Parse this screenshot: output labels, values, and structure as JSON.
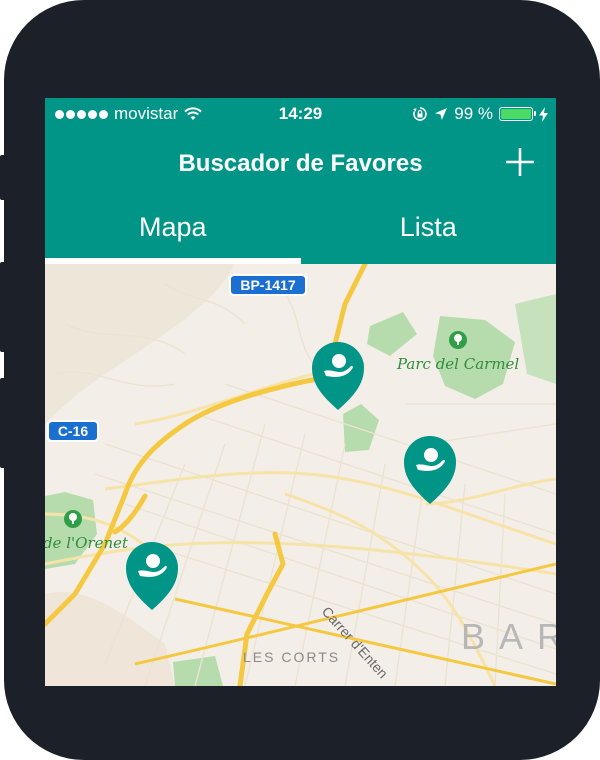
{
  "status_bar": {
    "carrier": "movistar",
    "time": "14:29",
    "battery_percent": "99 %",
    "battery_level": 0.99,
    "icons": [
      "signal-dots-icon",
      "wifi-icon",
      "rotation-lock-icon",
      "location-arrow-icon",
      "battery-icon",
      "charging-bolt-icon"
    ]
  },
  "navbar": {
    "title": "Buscador de Favores",
    "add_icon": "plus-icon"
  },
  "tabs": [
    {
      "label": "Mapa",
      "active": true
    },
    {
      "label": "Lista",
      "active": false
    }
  ],
  "map": {
    "road_shields": [
      "BP-1417",
      "C-16"
    ],
    "place_labels": [
      "Parc del Carmel",
      "de l'Orenet",
      "LES CORTS",
      "Carrer d'Enten",
      "BAR"
    ],
    "colors": {
      "accent": "#009587",
      "map_bg": "#f3efe8",
      "park": "#a8d8a0",
      "highway": "#f5c842",
      "shield": "#1b6fd1"
    },
    "pins": [
      {
        "name": "favor-pin-1",
        "icon": "helping-hand-icon"
      },
      {
        "name": "favor-pin-2",
        "icon": "helping-hand-icon"
      },
      {
        "name": "favor-pin-3",
        "icon": "helping-hand-icon"
      }
    ]
  }
}
